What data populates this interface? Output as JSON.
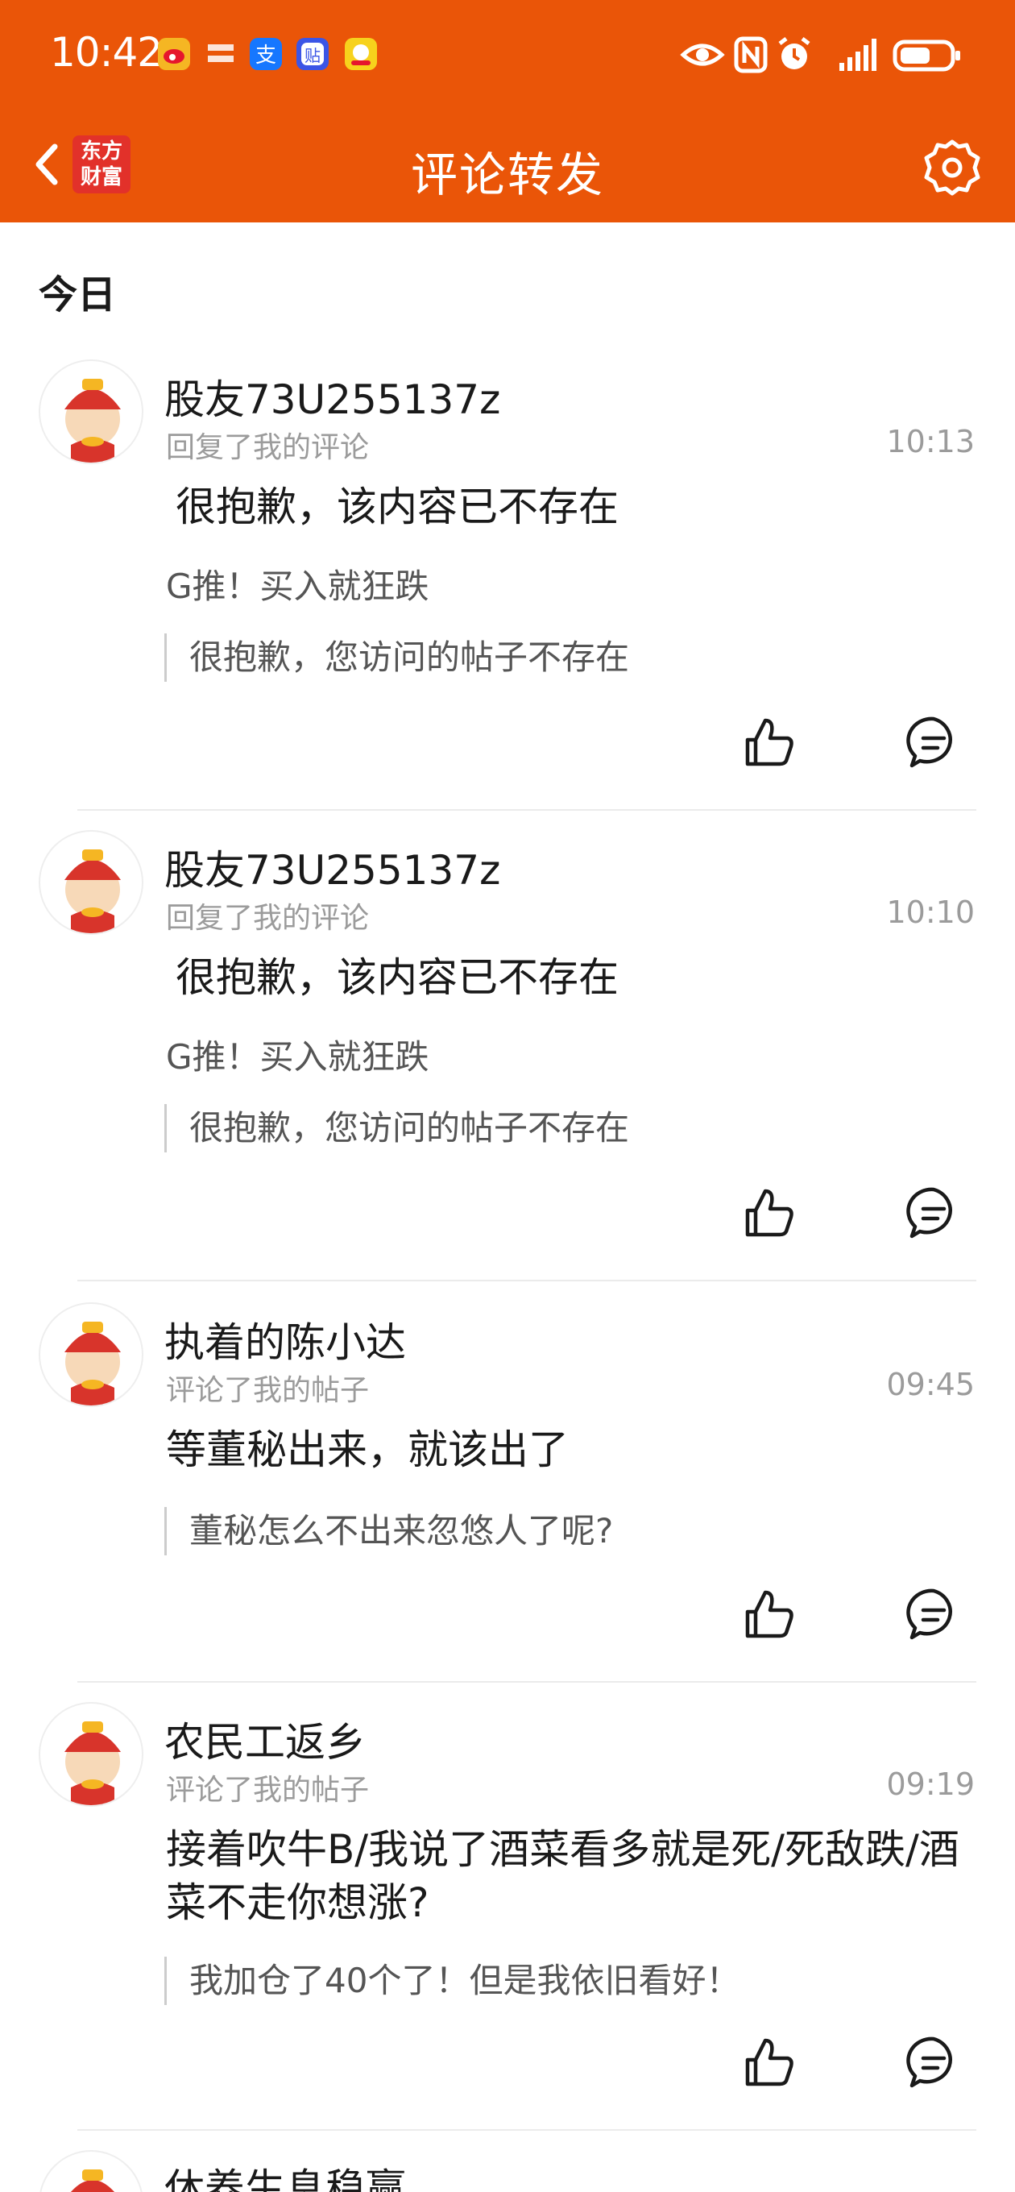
{
  "status_bar": {
    "time": "10:42"
  },
  "nav": {
    "title": "评论转发",
    "logo_text": "东方财富"
  },
  "section": {
    "today_label": "今日"
  },
  "items": [
    {
      "name": "股友73U255137z",
      "action": "回复了我的评论",
      "time": "10:13",
      "content": "很抱歉，该内容已不存在",
      "sub": "G推！买入就狂跌",
      "quote": "很抱歉，您访问的帖子不存在"
    },
    {
      "name": "股友73U255137z",
      "action": "回复了我的评论",
      "time": "10:10",
      "content": "很抱歉，该内容已不存在",
      "sub": "G推！买入就狂跌",
      "quote": "很抱歉，您访问的帖子不存在"
    },
    {
      "name": "执着的陈小达",
      "action": "评论了我的帖子",
      "time": "09:45",
      "content": "等董秘出来，就该出了",
      "quote": "董秘怎么不出来忽悠人了呢?"
    },
    {
      "name": "农民工返乡",
      "action": "评论了我的帖子",
      "time": "09:19",
      "content": "接着吹牛B/我说了酒菜看多就是死/死敌跌/酒菜不走你想涨?",
      "quote": "我加仓了40个了！但是我依旧看好！"
    },
    {
      "name": "休养生息稳赢"
    }
  ]
}
